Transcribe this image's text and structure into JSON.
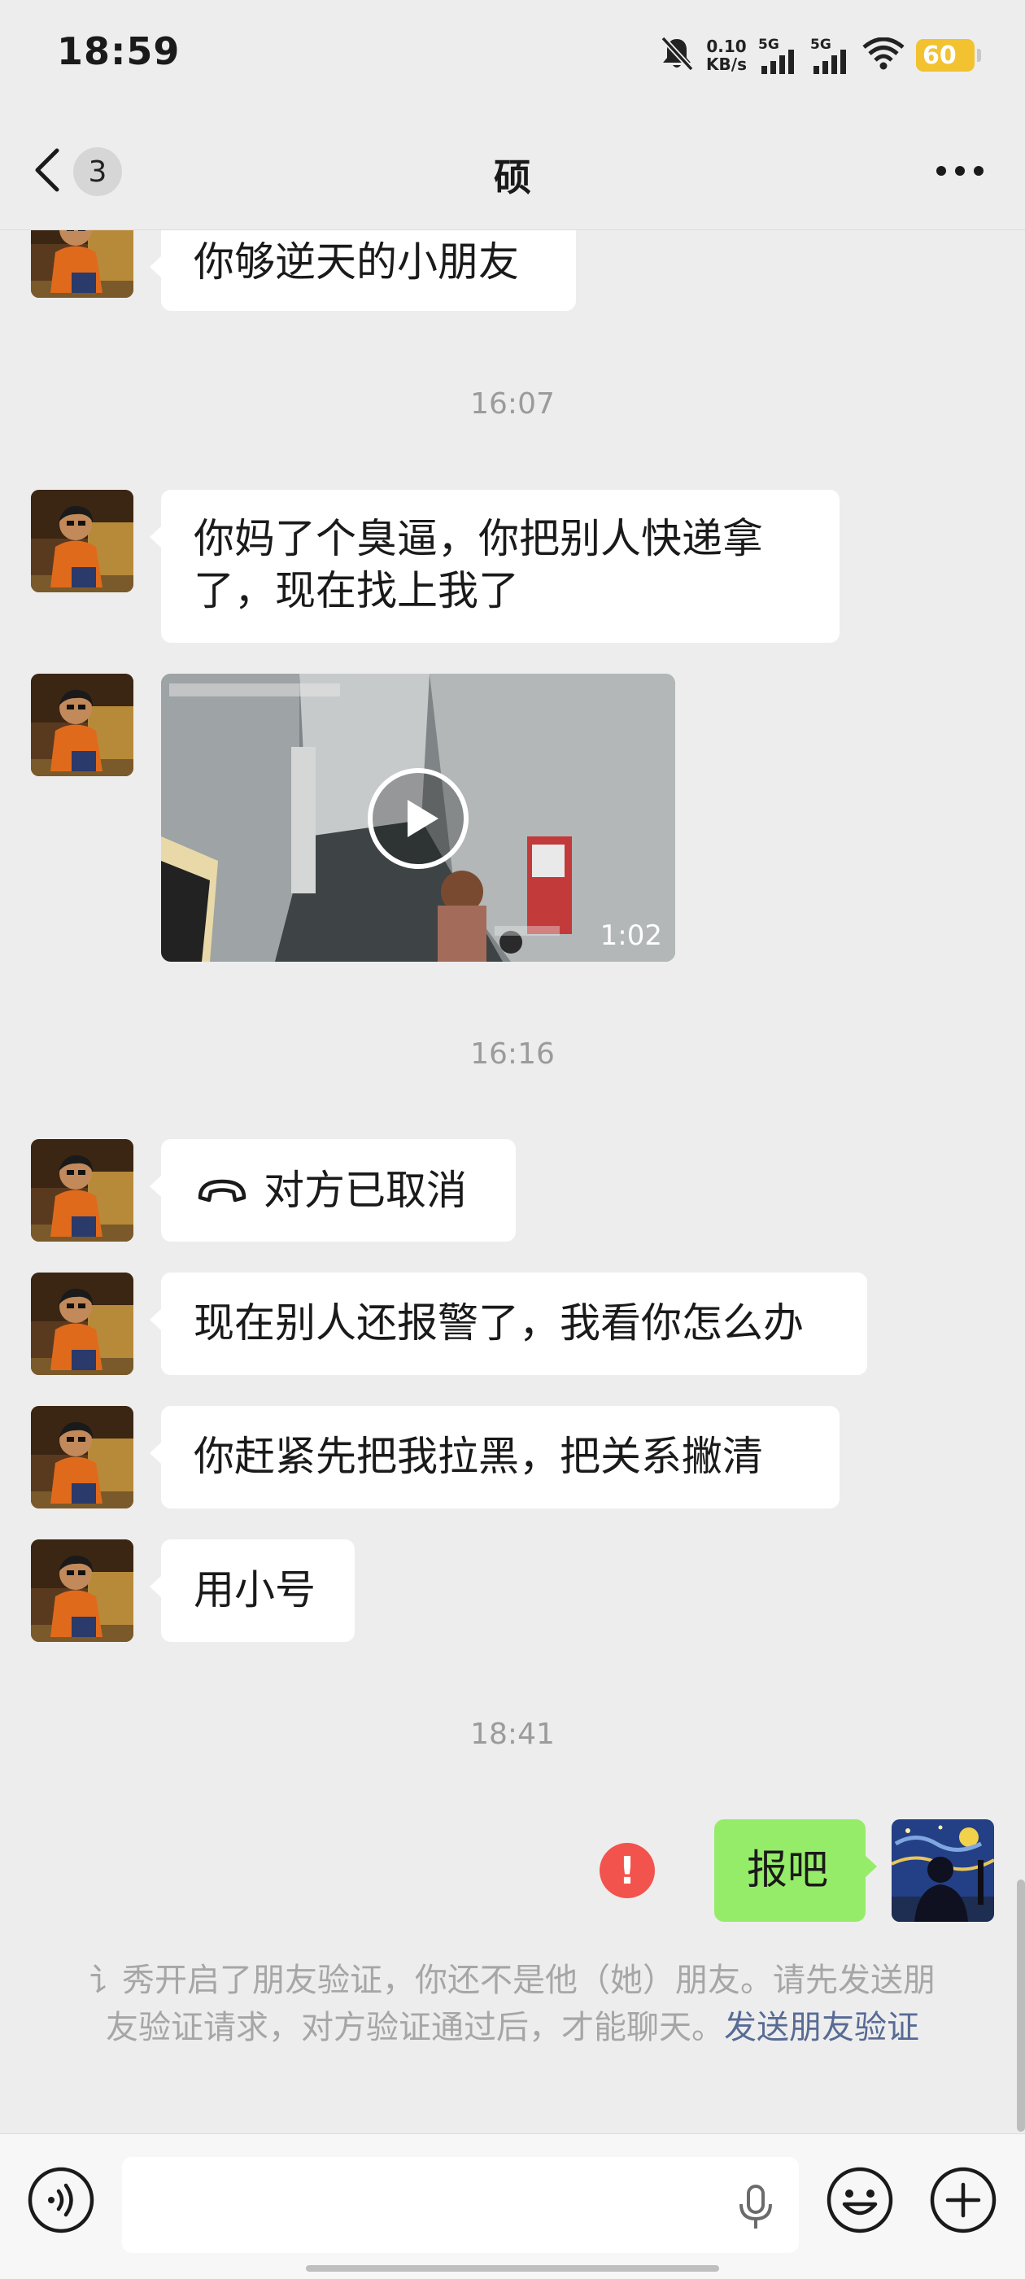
{
  "status_bar": {
    "time": "18:59",
    "net_speed_value": "0.10",
    "net_speed_unit": "KB/s",
    "sim1_label": "5G",
    "sim2_label": "5G",
    "battery": "60",
    "icons": [
      "bell-muted-icon",
      "signal-icon",
      "signal-icon",
      "wifi-icon",
      "battery-icon"
    ]
  },
  "header": {
    "back_badge_count": "3",
    "title": "硕",
    "more_icon": "more-dots-icon"
  },
  "messages": {
    "m1": "你够逆天的小朋友",
    "t1": "16:07",
    "m2": "你妈了个臭逼，你把别人快递拿了，现在找上我了",
    "video_duration": "1:02",
    "t2": "16:16",
    "call_status": "对方已取消",
    "m3": "现在别人还报警了，我看你怎么办",
    "m4": "你赶紧先把我拉黑，把关系撇清",
    "m5": "用小号",
    "t3": "18:41",
    "my_msg": "报吧",
    "error_mark": "!"
  },
  "system_notice": {
    "text": "讠秀开启了朋友验证，你还不是他（她）朋友。请先发送朋友验证请求，对方验证通过后，才能聊天。",
    "link": "发送朋友验证"
  },
  "input_bar": {
    "voice_icon": "voice-mode-icon",
    "mic_icon": "microphone-icon",
    "emoji_icon": "emoji-icon",
    "plus_icon": "plus-icon"
  },
  "colors": {
    "background": "#ededed",
    "incoming_bubble": "#ffffff",
    "outgoing_bubble": "#95ec69",
    "error_red": "#f2534d",
    "link_blue": "#576b95",
    "battery_yellow": "#f2c230"
  }
}
